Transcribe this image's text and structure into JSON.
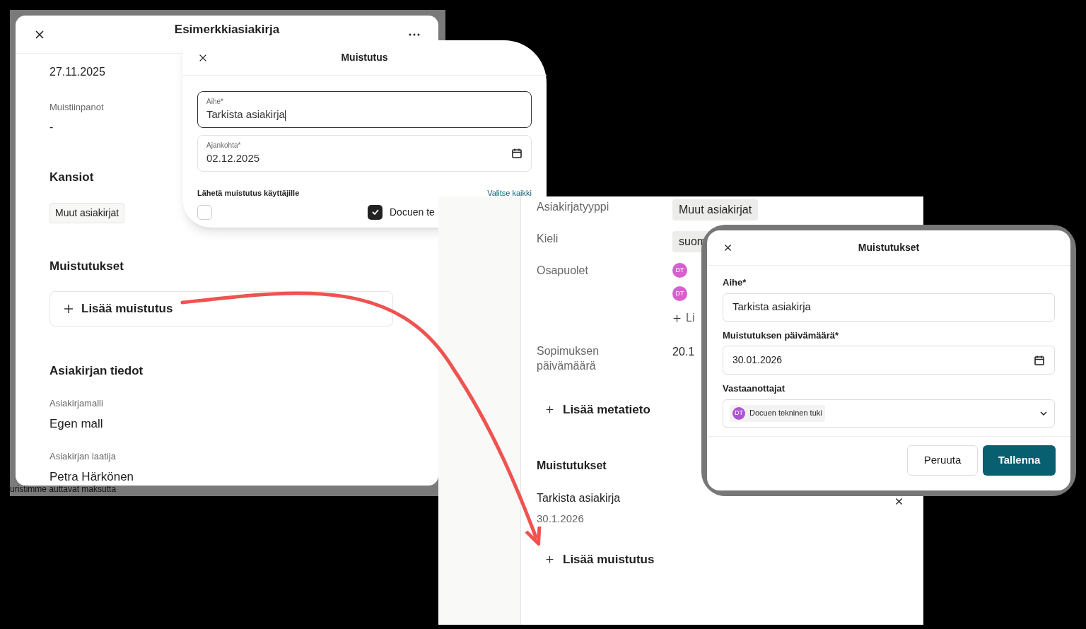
{
  "document_panel": {
    "title": "Esimerkkiasiakirja",
    "date": "27.11.2025",
    "notes_label": "Muistiinpanot",
    "notes_value": "-",
    "folders_heading": "Kansiot",
    "folder_chip": "Muut asiakirjat",
    "reminders_heading": "Muistutukset",
    "add_reminder": "Lisää muistutus",
    "details_heading": "Asiakirjan tiedot",
    "details": [
      {
        "label": "Asiakirjamalli",
        "value": "Egen mall"
      },
      {
        "label": "Asiakirjan laatija",
        "value": "Petra Härkönen"
      }
    ],
    "footer_text": "uristimme auttavat maksutta"
  },
  "reminder_dialog": {
    "title": "Muistutus",
    "fields": [
      {
        "label": "Aihe*",
        "value": "Tarkista asiakirja",
        "kind": "text",
        "focused": true
      },
      {
        "label": "Ajankohta*",
        "value": "02.12.2025",
        "kind": "date",
        "focused": false
      }
    ],
    "recipients_label": "Lähetä muistutus käyttäjille",
    "select_all": "Valitse kaikki",
    "recipients": [
      {
        "checked": false
      },
      {
        "checked": true,
        "label": "Docuen te"
      }
    ]
  },
  "metadata_panel": {
    "rows": [
      {
        "label": "Asiakirjatyyppi",
        "kind": "chip",
        "value": "Muut asiakirjat"
      },
      {
        "label": "Kieli",
        "kind": "chip",
        "value": "suom"
      },
      {
        "label": "Osapuolet",
        "kind": "parties",
        "parties": [
          {
            "initials": "DT"
          },
          {
            "initials": "DT"
          }
        ],
        "add": "Li"
      },
      {
        "label": "Sopimuksen päivämäärä",
        "kind": "text",
        "value": "20.1"
      }
    ],
    "add_metadata": "Lisää metatieto",
    "reminders_heading": "Muistutukset",
    "reminders": [
      {
        "title": "Tarkista asiakirja",
        "date": "30.1.2026"
      }
    ],
    "add_reminder": "Lisää muistutus"
  },
  "reminders_dialog": {
    "title": "Muistutukset",
    "subject_label": "Aihe*",
    "subject_value": "Tarkista asiakirja",
    "date_label": "Muistutuksen päivämäärä*",
    "date_value": "30.01.2026",
    "recipients_label": "Vastaanottajat",
    "recipients": [
      {
        "initials": "DT",
        "name": "Docuen tekninen tuki"
      }
    ],
    "cancel": "Peruuta",
    "save": "Tallenna"
  }
}
